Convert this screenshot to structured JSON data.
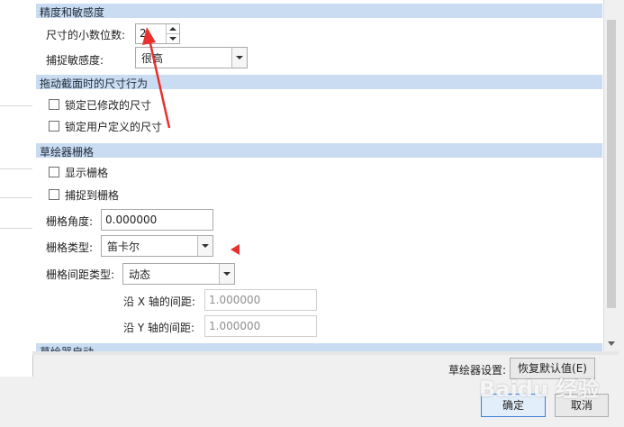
{
  "sections": {
    "precision": "精度和敏感度",
    "drag": "拖动截面时的尺寸行为",
    "grid": "草绘器栅格",
    "startup": "草绘器启动"
  },
  "precision": {
    "decimal_label": "尺寸的小数位数:",
    "decimal_value": "2",
    "snap_label": "捕捉敏感度:",
    "snap_value": "很高"
  },
  "drag": {
    "lock_modified": "锁定已修改的尺寸",
    "lock_user": "锁定用户定义的尺寸"
  },
  "grid": {
    "show_grid": "显示栅格",
    "snap_to_grid": "捕捉到栅格",
    "angle_label": "栅格角度:",
    "angle_value": "0.000000",
    "type_label": "栅格类型:",
    "type_value": "笛卡尔",
    "spacing_type_label": "栅格间距类型:",
    "spacing_type_value": "动态",
    "x_spacing_label": "沿 X 轴的间距:",
    "x_spacing_value": "1.000000",
    "y_spacing_label": "沿 Y 轴的间距:",
    "y_spacing_value": "1.000000"
  },
  "footer": {
    "settings_label": "草绘器设置:",
    "restore_button": "恢复默认值(E)",
    "ok_button": "确定",
    "cancel_button": "取消"
  },
  "colors": {
    "section_header": "#c9dcf2",
    "annotation_arrow": "#e8302e",
    "primary_button_border": "#3c7fd6"
  },
  "watermark": "Baidu 经验"
}
